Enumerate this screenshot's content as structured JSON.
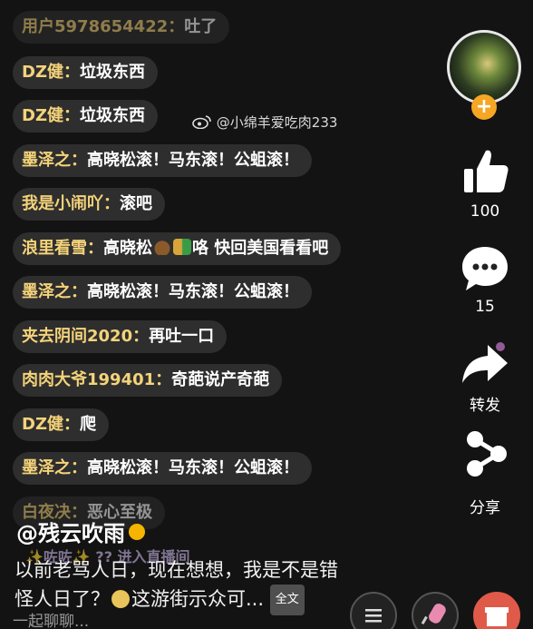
{
  "messages": [
    {
      "user": "用户5978654422：",
      "text": "吐了"
    },
    {
      "user": "DZ健：",
      "text": "垃圾东西"
    },
    {
      "user": "DZ健：",
      "text": "垃圾东西"
    },
    {
      "user": "墨泽之：",
      "text": "高晓松滚！马东滚！公蛆滚！"
    },
    {
      "user": "我是小闹吖：",
      "text": "滚吧"
    },
    {
      "user": "浪里看雪：",
      "text_before": "高晓松",
      "text_after": "咯 快回美国看看吧"
    },
    {
      "user": "墨泽之：",
      "text": "高晓松滚！马东滚！公蛆滚！"
    },
    {
      "user": "夹去阴间2020：",
      "text": "再吐一口"
    },
    {
      "user": "肉肉大爷199401：",
      "text": "奇葩说产奇葩"
    },
    {
      "user": "DZ健：",
      "text": "爬"
    },
    {
      "user": "墨泽之：",
      "text": "高晓松滚！马东滚！公蛆滚！"
    },
    {
      "user": "白夜决：",
      "text": "恶心至极"
    }
  ],
  "entry_notice": "✨咗咗✨ ?? 进入直播间",
  "watermark": "@小绵羊爱吃肉233",
  "sidebar": {
    "like_count": "100",
    "comment_count": "15",
    "share_label": "转发",
    "share2_label": "分享"
  },
  "author": "@残云吹雨",
  "caption_line1": "以前老骂人日，现在想想，我是不是错",
  "caption_line2": "怪人日了？",
  "caption_line2_after": "这游街示众可...",
  "full_text_label": "全文",
  "chat_input_placeholder": "一起聊聊...",
  "colors": {
    "username": "#f4d37a",
    "follow": "#f5a623",
    "background": "#131313"
  },
  "icons": [
    "plus-icon",
    "thumbs-up-icon",
    "comment-bubble-icon",
    "forward-arrow-icon",
    "share-nodes-icon",
    "menu-icon",
    "gift-icon"
  ]
}
